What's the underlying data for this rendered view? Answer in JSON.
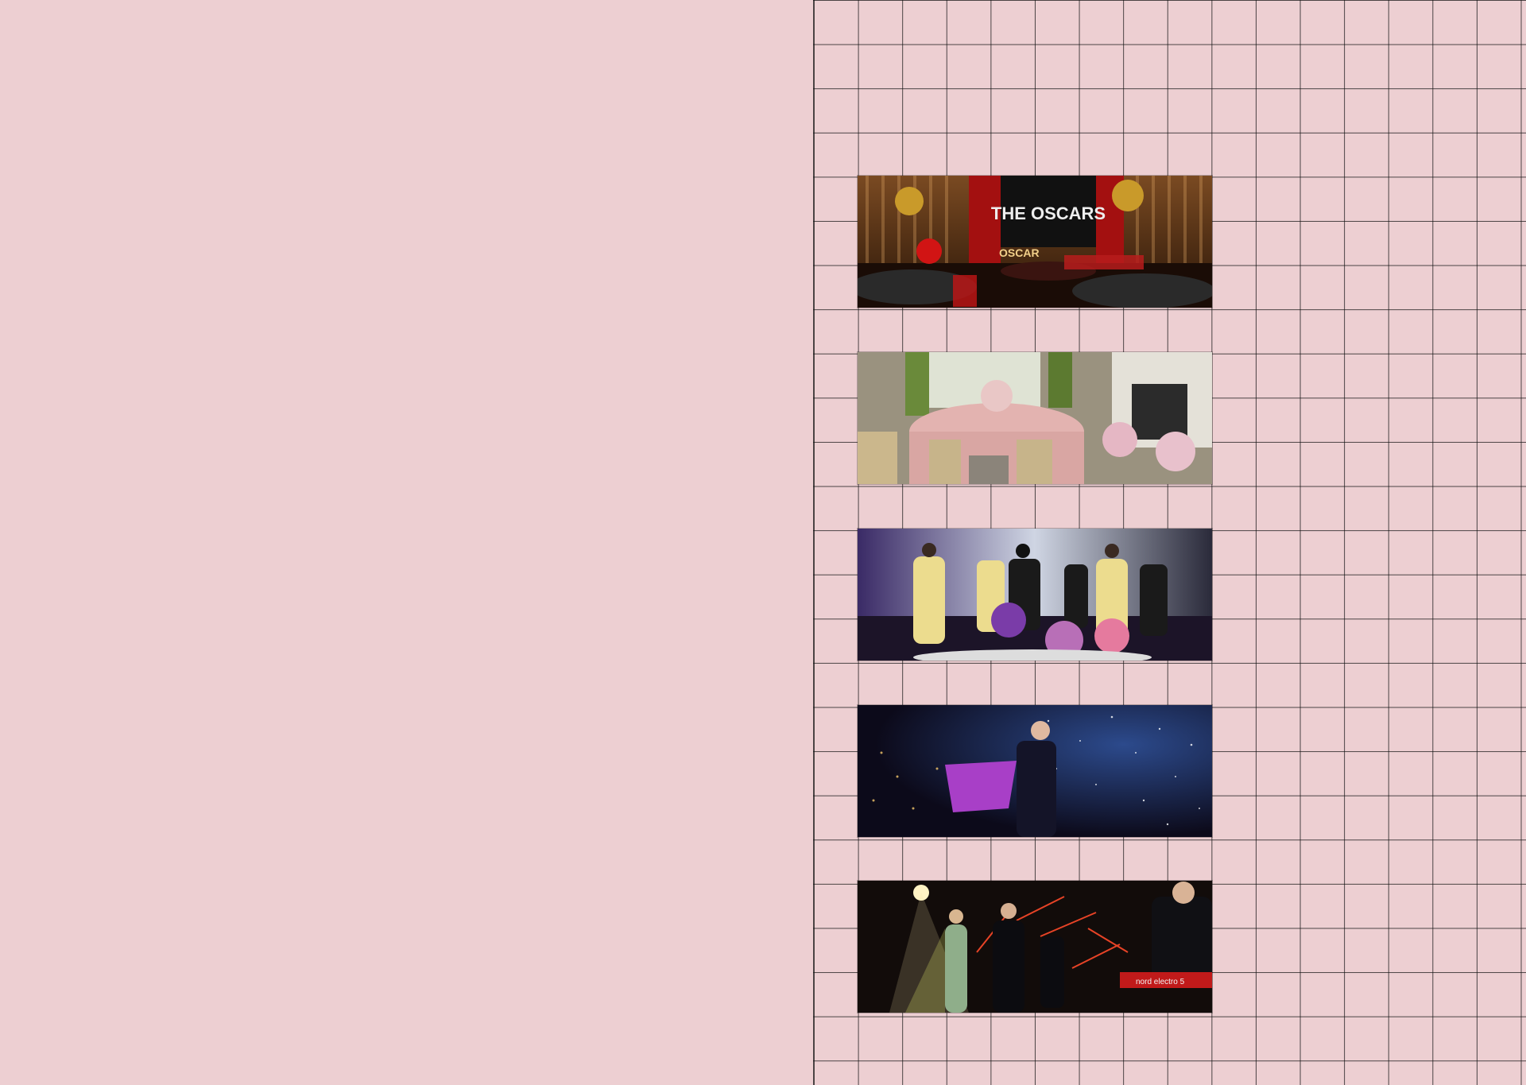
{
  "photos": [
    {
      "icon": "oscars-banquet-photo",
      "stage_sign": "THE OSCARS",
      "floor_sign": "OSCAR"
    },
    {
      "icon": "pink-dining-room-photo"
    },
    {
      "icon": "dance-performance-photo"
    },
    {
      "icon": "magician-performance-photo"
    },
    {
      "icon": "live-band-photo",
      "keyboard_label": "nord electro 5"
    }
  ],
  "colors": {
    "background": "#edcfd2",
    "grid_line": "#141414"
  }
}
